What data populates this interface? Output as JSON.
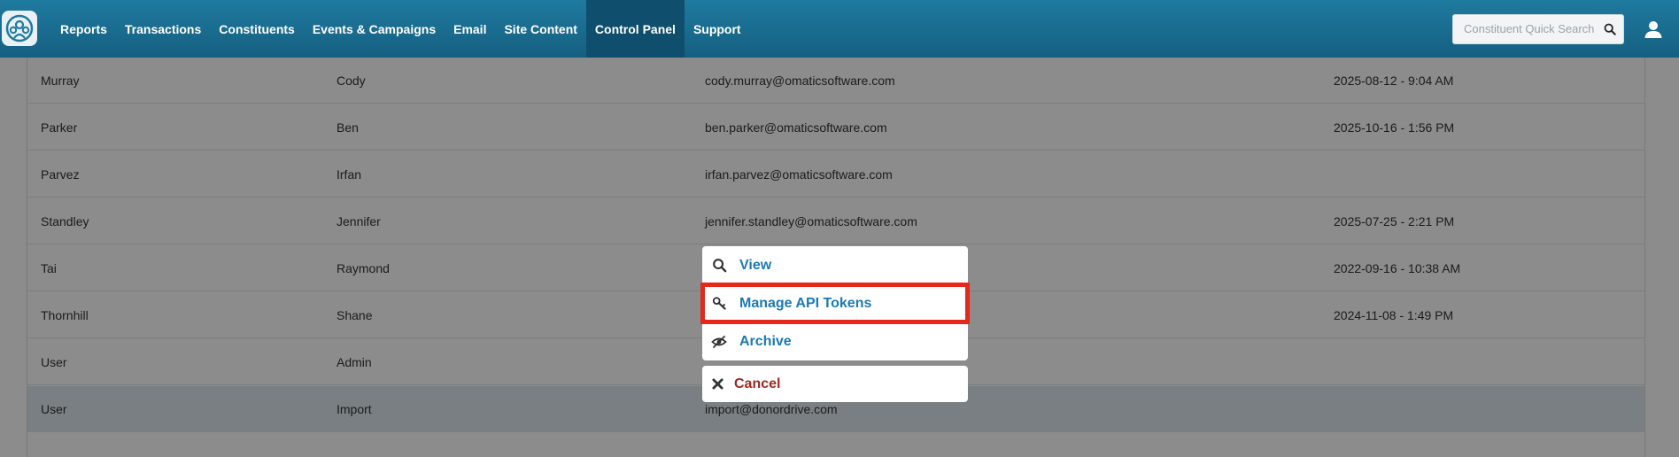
{
  "nav": {
    "items": [
      {
        "label": "Reports",
        "active": false
      },
      {
        "label": "Transactions",
        "active": false
      },
      {
        "label": "Constituents",
        "active": false
      },
      {
        "label": "Events & Campaigns",
        "active": false
      },
      {
        "label": "Email",
        "active": false
      },
      {
        "label": "Site Content",
        "active": false
      },
      {
        "label": "Control Panel",
        "active": true
      },
      {
        "label": "Support",
        "active": false
      }
    ],
    "search": {
      "placeholder": "Constituent Quick Search",
      "value": ""
    },
    "colors": {
      "nav_bg": "#1a6f93",
      "active_bg": "#0f4f6d"
    }
  },
  "table": {
    "rows": [
      {
        "last": "Murray",
        "first": "Cody",
        "email": "cody.murray@omaticsoftware.com",
        "last_login": "2025-08-12 - 9:04 AM",
        "highlight": false
      },
      {
        "last": "Parker",
        "first": "Ben",
        "email": "ben.parker@omaticsoftware.com",
        "last_login": "2025-10-16 - 1:56 PM",
        "highlight": false
      },
      {
        "last": "Parvez",
        "first": "Irfan",
        "email": "irfan.parvez@omaticsoftware.com",
        "last_login": "",
        "highlight": false
      },
      {
        "last": "Standley",
        "first": "Jennifer",
        "email": "jennifer.standley@omaticsoftware.com",
        "last_login": "2025-07-25 - 2:21 PM",
        "highlight": false
      },
      {
        "last": "Tai",
        "first": "Raymond",
        "email": "",
        "last_login": "2022-09-16 - 10:38 AM",
        "highlight": false
      },
      {
        "last": "Thornhill",
        "first": "Shane",
        "email": "",
        "last_login": "2024-11-08 - 1:49 PM",
        "highlight": false
      },
      {
        "last": "User",
        "first": "Admin",
        "email": "",
        "last_login": "",
        "highlight": false
      },
      {
        "last": "User",
        "first": "Import",
        "email": "import@donordrive.com",
        "last_login": "",
        "highlight": true
      },
      {
        "last": "",
        "first": "",
        "email": "",
        "last_login": "",
        "highlight": false
      }
    ]
  },
  "action_menu": {
    "items": [
      {
        "label": "View",
        "icon": "search-icon",
        "highlighted": false
      },
      {
        "label": "Manage API Tokens",
        "icon": "key-icon",
        "highlighted": true
      },
      {
        "label": "Archive",
        "icon": "archive-eye-icon",
        "highlighted": false
      }
    ],
    "cancel": {
      "label": "Cancel",
      "icon": "close-icon"
    },
    "colors": {
      "link": "#1a7ab5",
      "cancel": "#a0291f",
      "highlight_border": "#e8271a"
    }
  }
}
